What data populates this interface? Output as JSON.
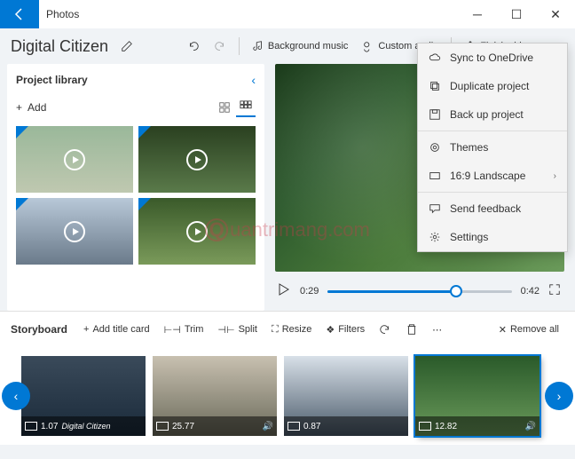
{
  "titlebar": {
    "app": "Photos"
  },
  "toolbar": {
    "project_title": "Digital Citizen",
    "bg_music": "Background music",
    "custom_audio": "Custom audio",
    "finish": "Finish video"
  },
  "library": {
    "title": "Project library",
    "add": "Add"
  },
  "playback": {
    "current": "0:29",
    "total": "0:42"
  },
  "storyboard": {
    "title": "Storyboard",
    "add_title": "Add title card",
    "trim": "Trim",
    "split": "Split",
    "resize": "Resize",
    "filters": "Filters",
    "remove_all": "Remove all",
    "clips": [
      {
        "dur": "1.07",
        "label": "Digital Citizen"
      },
      {
        "dur": "25.77"
      },
      {
        "dur": "0.87"
      },
      {
        "dur": "12.82"
      }
    ]
  },
  "menu": {
    "sync": "Sync to OneDrive",
    "duplicate": "Duplicate project",
    "backup": "Back up project",
    "themes": "Themes",
    "aspect": "16:9 Landscape",
    "feedback": "Send feedback",
    "settings": "Settings"
  },
  "watermark": "uantrimang.com"
}
